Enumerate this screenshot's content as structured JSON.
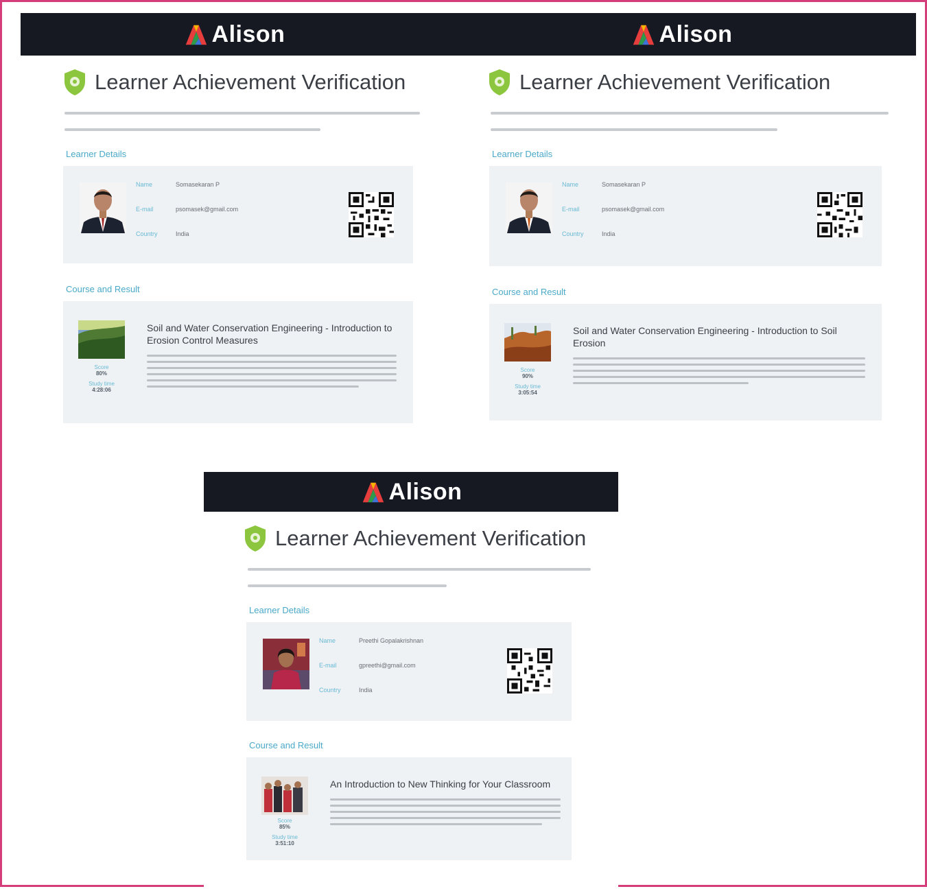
{
  "brand": {
    "name": "Alison"
  },
  "certificates": [
    {
      "heading": "Learner Achievement Verification",
      "intro": "",
      "learner_section_label": "Learner Details",
      "learner": {
        "name_label": "Name",
        "name": "Somasekaran P",
        "email_label": "E-mail",
        "email": "psomasek@gmail.com",
        "country_label": "Country",
        "country": "India"
      },
      "course_section_label": "Course and Result",
      "course": {
        "title": "Soil and Water Conservation Engineering - Introduction to Erosion Control Measures",
        "score_label": "Score",
        "score": "80%",
        "study_time_label": "Study time",
        "study_time": "4:28:06"
      }
    },
    {
      "heading": "Learner Achievement Verification",
      "intro": "",
      "learner_section_label": "Learner Details",
      "learner": {
        "name_label": "Name",
        "name": "Somasekaran P",
        "email_label": "E-mail",
        "email": "psomasek@gmail.com",
        "country_label": "Country",
        "country": "India"
      },
      "course_section_label": "Course and Result",
      "course": {
        "title": "Soil and Water Conservation Engineering - Introduction to Soil Erosion",
        "score_label": "Score",
        "score": "90%",
        "study_time_label": "Study time",
        "study_time": "3:05:54"
      }
    },
    {
      "heading": "Learner Achievement Verification",
      "intro": "",
      "learner_section_label": "Learner Details",
      "learner": {
        "name_label": "Name",
        "name": "Preethi Gopalakrishnan",
        "email_label": "E-mail",
        "email": "gpreethi@gmail.com",
        "country_label": "Country",
        "country": "India"
      },
      "course_section_label": "Course and Result",
      "course": {
        "title": "An Introduction to New Thinking for Your Classroom",
        "score_label": "Score",
        "score": "85%",
        "study_time_label": "Study time",
        "study_time": "3:51:10"
      }
    }
  ],
  "colors": {
    "header_bar": "#161922",
    "accent_teal": "#4aa9c9",
    "shield_green": "#8cc63f",
    "panel_bg": "#eef2f5",
    "frame_border": "#d43d7a"
  }
}
